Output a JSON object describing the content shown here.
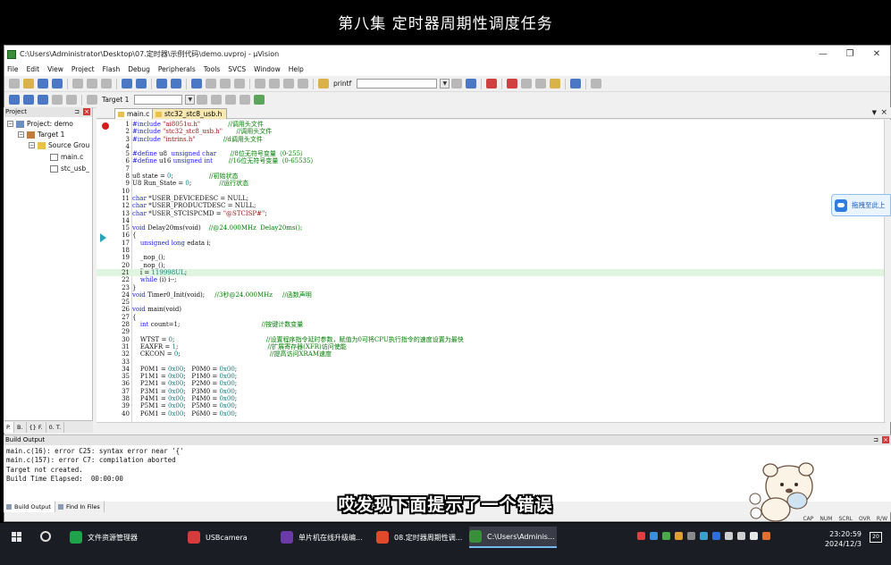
{
  "banner": {
    "title": "第八集 定时器周期性调度任务"
  },
  "window": {
    "title": "C:\\Users\\Administrator\\Desktop\\07.定时器\\示例代码\\demo.uvproj - µVision",
    "controls": {
      "minimize": "—",
      "maximize": "❐",
      "close": "✕"
    }
  },
  "menu": [
    "File",
    "Edit",
    "View",
    "Project",
    "Flash",
    "Debug",
    "Peripherals",
    "Tools",
    "SVCS",
    "Window",
    "Help"
  ],
  "toolbar": {
    "find_text": "printf",
    "target": "Target 1"
  },
  "project": {
    "header": "Project",
    "tree": {
      "project": "Project: demo",
      "target": "Target 1",
      "group": "Source Grou",
      "files": [
        "main.c",
        "stc_usb_"
      ]
    },
    "tabs": [
      "P.",
      "B.",
      "{} F.",
      "0. T."
    ]
  },
  "editor": {
    "tabs": [
      "main.c",
      "stc32_stc8_usb.h"
    ],
    "lines": [
      {
        "n": "1",
        "segs": [
          [
            "pp",
            "#include "
          ],
          [
            "str",
            "\"ai8051u.h\""
          ],
          [
            "",
            "              "
          ],
          [
            "cm",
            "//调用头文件"
          ]
        ]
      },
      {
        "n": "2",
        "segs": [
          [
            "pp",
            "#include "
          ],
          [
            "str",
            "\"stc32_stc8_usb.h\""
          ],
          [
            "",
            "       "
          ],
          [
            "cm",
            "//调用头文件"
          ]
        ]
      },
      {
        "n": "3",
        "segs": [
          [
            "pp",
            "#include "
          ],
          [
            "str",
            "\"intrins.h\""
          ],
          [
            "",
            "              "
          ],
          [
            "cm",
            "//d调用头文件"
          ]
        ]
      },
      {
        "n": "4",
        "segs": []
      },
      {
        "n": "5",
        "segs": [
          [
            "pp",
            "#define "
          ],
          [
            "",
            "u8  "
          ],
          [
            "kw",
            "unsigned char"
          ],
          [
            "",
            "       "
          ],
          [
            "cm",
            "//8位无符号变量（0-255）"
          ]
        ]
      },
      {
        "n": "6",
        "segs": [
          [
            "pp",
            "#define "
          ],
          [
            "",
            "u16 "
          ],
          [
            "kw",
            "unsigned int"
          ],
          [
            "",
            "        "
          ],
          [
            "cm",
            "//16位无符号变量（0-65535）"
          ]
        ]
      },
      {
        "n": "7",
        "segs": []
      },
      {
        "n": "8",
        "segs": [
          [
            "",
            "u8 state = "
          ],
          [
            "num",
            "0"
          ],
          [
            "",
            ";"
          ],
          [
            "",
            "                  "
          ],
          [
            "cm",
            "//初始状态"
          ]
        ]
      },
      {
        "n": "9",
        "segs": [
          [
            "",
            "U8 Run_State = "
          ],
          [
            "num",
            "0"
          ],
          [
            "",
            ";"
          ],
          [
            "",
            "              "
          ],
          [
            "cm",
            "//运行状态"
          ]
        ]
      },
      {
        "n": "10",
        "segs": []
      },
      {
        "n": "11",
        "segs": [
          [
            "kw",
            "char "
          ],
          [
            "",
            "*USER_DEVICEDESC = NULL;"
          ]
        ]
      },
      {
        "n": "12",
        "segs": [
          [
            "kw",
            "char "
          ],
          [
            "",
            "*USER_PRODUCTDESC = NULL;"
          ]
        ]
      },
      {
        "n": "13",
        "segs": [
          [
            "kw",
            "char "
          ],
          [
            "",
            "*USER_STCISPCMD = "
          ],
          [
            "str",
            "\"@STCISP#\""
          ],
          [
            "",
            ";"
          ]
        ]
      },
      {
        "n": "14",
        "segs": []
      },
      {
        "n": "15",
        "segs": [
          [
            "kw",
            "void "
          ],
          [
            "",
            "Delay20ms(void)    "
          ],
          [
            "cm",
            "//@24.000MHz  Delay20ms();"
          ]
        ]
      },
      {
        "n": "16",
        "segs": [
          [
            "",
            "{"
          ]
        ]
      },
      {
        "n": "17",
        "segs": [
          [
            "",
            "    "
          ],
          [
            "kw",
            "unsigned long "
          ],
          [
            "",
            "edata i;"
          ]
        ]
      },
      {
        "n": "18",
        "segs": []
      },
      {
        "n": "19",
        "segs": [
          [
            "",
            "    _nop_();"
          ]
        ]
      },
      {
        "n": "20",
        "segs": [
          [
            "",
            "    _nop_();"
          ]
        ]
      },
      {
        "n": "21",
        "hl": true,
        "segs": [
          [
            "",
            "    i = "
          ],
          [
            "num",
            "119998UL"
          ],
          [
            "",
            ";"
          ]
        ]
      },
      {
        "n": "22",
        "segs": [
          [
            "",
            "    "
          ],
          [
            "kw",
            "while "
          ],
          [
            "",
            "(i) i--;"
          ]
        ]
      },
      {
        "n": "23",
        "segs": [
          [
            "",
            "}"
          ]
        ]
      },
      {
        "n": "24",
        "segs": [
          [
            "kw",
            "void "
          ],
          [
            "",
            "Timer0_Init(void);     "
          ],
          [
            "cm",
            "//3秒@24.000MHz     //函数声明"
          ]
        ]
      },
      {
        "n": "25",
        "segs": []
      },
      {
        "n": "26",
        "segs": [
          [
            "kw",
            "void "
          ],
          [
            "",
            "main(void)"
          ]
        ]
      },
      {
        "n": "27",
        "segs": [
          [
            "",
            "{"
          ]
        ]
      },
      {
        "n": "28",
        "segs": [
          [
            "",
            "    "
          ],
          [
            "kw",
            "int "
          ],
          [
            "",
            "count=1;"
          ],
          [
            "",
            "                                         "
          ],
          [
            "cm",
            "//按键计数变量"
          ]
        ]
      },
      {
        "n": "29",
        "segs": []
      },
      {
        "n": "30",
        "segs": [
          [
            "",
            "    WTST = "
          ],
          [
            "num",
            "0"
          ],
          [
            "",
            ";"
          ],
          [
            "",
            "                                              "
          ],
          [
            "cm",
            "//设置程序指令延时参数，赋值为0可将CPU执行指令的速度设置为最快"
          ]
        ]
      },
      {
        "n": "31",
        "segs": [
          [
            "",
            "    EAXFR = "
          ],
          [
            "num",
            "1"
          ],
          [
            "",
            ";"
          ],
          [
            "",
            "                                             "
          ],
          [
            "cm",
            "//扩展寄存器(XFR)访问使能"
          ]
        ]
      },
      {
        "n": "32",
        "segs": [
          [
            "",
            "    CKCON = "
          ],
          [
            "num",
            "0"
          ],
          [
            "",
            ";"
          ],
          [
            "",
            "                                             "
          ],
          [
            "cm",
            "//提高访问XRAM速度"
          ]
        ]
      },
      {
        "n": "33",
        "segs": []
      },
      {
        "n": "34",
        "segs": [
          [
            "",
            "    P0M1 = "
          ],
          [
            "num",
            "0x00"
          ],
          [
            "",
            ";   P0M0 = "
          ],
          [
            "num",
            "0x00"
          ],
          [
            "",
            ";"
          ]
        ]
      },
      {
        "n": "35",
        "segs": [
          [
            "",
            "    P1M1 = "
          ],
          [
            "num",
            "0x00"
          ],
          [
            "",
            ";   P1M0 = "
          ],
          [
            "num",
            "0x00"
          ],
          [
            "",
            ";"
          ]
        ]
      },
      {
        "n": "36",
        "segs": [
          [
            "",
            "    P2M1 = "
          ],
          [
            "num",
            "0x00"
          ],
          [
            "",
            ";   P2M0 = "
          ],
          [
            "num",
            "0x00"
          ],
          [
            "",
            ";"
          ]
        ]
      },
      {
        "n": "37",
        "segs": [
          [
            "",
            "    P3M1 = "
          ],
          [
            "num",
            "0x00"
          ],
          [
            "",
            ";   P3M0 = "
          ],
          [
            "num",
            "0x00"
          ],
          [
            "",
            ";"
          ]
        ]
      },
      {
        "n": "38",
        "segs": [
          [
            "",
            "    P4M1 = "
          ],
          [
            "num",
            "0x00"
          ],
          [
            "",
            ";   P4M0 = "
          ],
          [
            "num",
            "0x00"
          ],
          [
            "",
            ";"
          ]
        ]
      },
      {
        "n": "39",
        "segs": [
          [
            "",
            "    P5M1 = "
          ],
          [
            "num",
            "0x00"
          ],
          [
            "",
            ";   P5M0 = "
          ],
          [
            "num",
            "0x00"
          ],
          [
            "",
            ";"
          ]
        ]
      },
      {
        "n": "40",
        "segs": [
          [
            "",
            "    P6M1 = "
          ],
          [
            "num",
            "0x00"
          ],
          [
            "",
            ";   P6M0 = "
          ],
          [
            "num",
            "0x00"
          ],
          [
            "",
            ";"
          ]
        ]
      }
    ]
  },
  "build": {
    "header": "Build Output",
    "lines": [
      "main.c(16): error C25: syntax error near '{'",
      "main.c(157): error C7: compilation aborted",
      "Target not created.",
      "Build Time Elapsed:  00:00:00"
    ],
    "tabs": [
      "Build Output",
      "Find In Files"
    ]
  },
  "status": [
    "CAP",
    "NUM",
    "SCRL",
    "OVR",
    "R/W"
  ],
  "float_widget": "拖拽至此上",
  "subtitle": "哎发现下面提示了一个错误",
  "taskbar": {
    "apps": [
      "文件资源管理器",
      "USBcamera",
      "单片机在线升级编...",
      "08.定时器周期性调...",
      "C:\\Users\\Adminis..."
    ],
    "time": "23:20:59",
    "date": "2024/12/3",
    "notification_count": "20"
  },
  "colors": {
    "keyword": "#1c1cff",
    "comment": "#008000",
    "string": "#a31515",
    "number": "#0a8080",
    "highlight": "#dff5df"
  }
}
